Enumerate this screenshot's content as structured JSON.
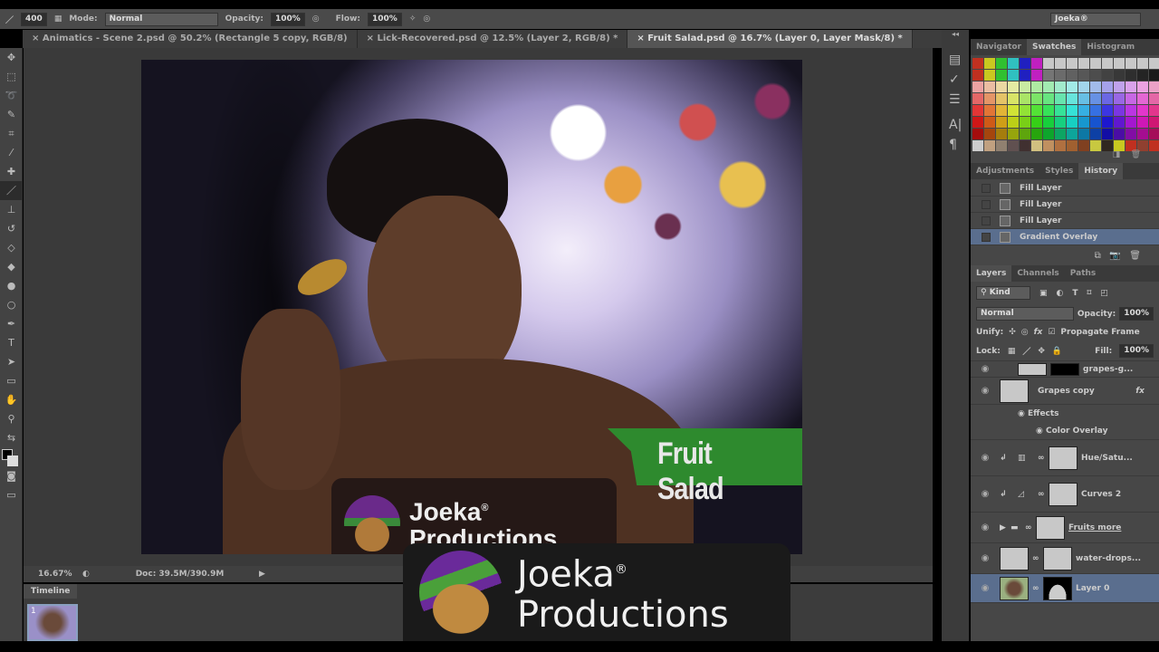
{
  "options": {
    "brush_size": "400",
    "mode_label": "Mode:",
    "mode": "Normal",
    "opacity_label": "Opacity:",
    "opacity": "100%",
    "flow_label": "Flow:",
    "flow": "100%",
    "workspace": "Joeka®"
  },
  "tabs": [
    {
      "label": "Animatics - Scene 2.psd @ 50.2% (Rectangle 5 copy, RGB/8)"
    },
    {
      "label": "Lick-Recovered.psd @ 12.5% (Layer 2, RGB/8) *"
    },
    {
      "label": "Fruit Salad.psd @ 16.7% (Layer 0, Layer Mask/8) *"
    }
  ],
  "canvas": {
    "banner_text": "Fruit Salad",
    "logo_name": "Joeka",
    "logo_sub": "Productions",
    "reg": "®"
  },
  "status": {
    "zoom": "16.67%",
    "doc": "Doc: 39.5M/390.9M"
  },
  "timeline": {
    "label": "Timeline",
    "frame": "1"
  },
  "panels": {
    "top_tabs": [
      "Navigator",
      "Swatches",
      "Histogram"
    ],
    "mid_tabs": [
      "Adjustments",
      "Styles",
      "History"
    ],
    "history": [
      "Fill Layer",
      "Fill Layer",
      "Fill Layer",
      "Gradient Overlay"
    ],
    "layer_tabs": [
      "Layers",
      "Channels",
      "Paths"
    ],
    "kind": "Kind",
    "blend": "Normal",
    "opacity_label": "Opacity:",
    "opacity": "100%",
    "unify": "Unify:",
    "propagate": "Propagate Frame",
    "lock": "Lock:",
    "fill_label": "Fill:",
    "fill": "100%",
    "layers": [
      {
        "name": "grapes-g..."
      },
      {
        "name": "Grapes copy",
        "fx": "fx",
        "effects": "Effects",
        "effect": "Color Overlay"
      },
      {
        "name": "Hue/Satu..."
      },
      {
        "name": "Curves 2"
      },
      {
        "name": "Fruits more"
      },
      {
        "name": "water-drops..."
      },
      {
        "name": "Layer 0"
      }
    ]
  },
  "overlay": {
    "name": "Joeka",
    "sub": "Productions",
    "reg": "®"
  }
}
